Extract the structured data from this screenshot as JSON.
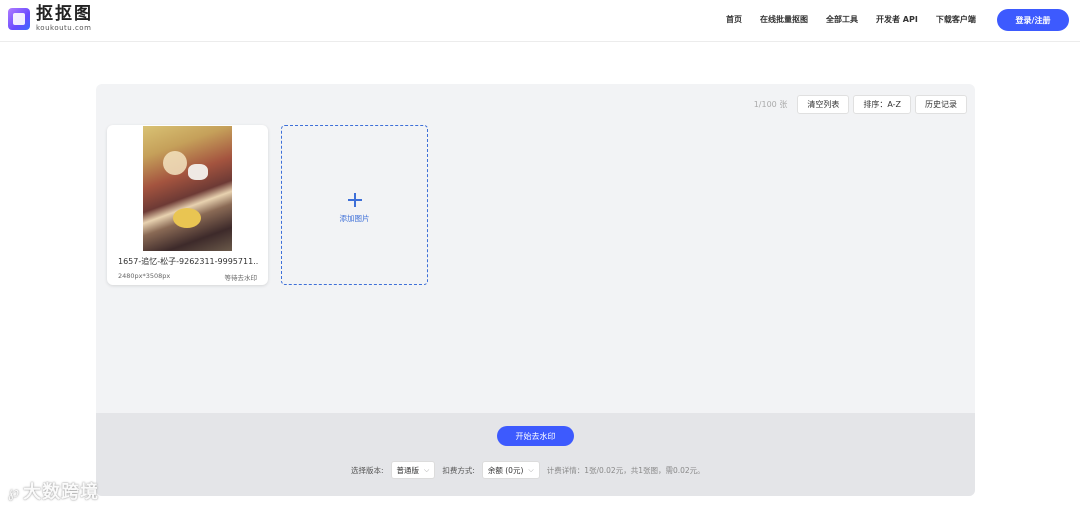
{
  "header": {
    "logo_cn": "抠抠图",
    "logo_en": "koukoutu.com",
    "nav": [
      "首页",
      "在线批量抠图",
      "全部工具",
      "开发者 API",
      "下载客户端"
    ],
    "login": "登录/注册"
  },
  "toolbar": {
    "count": "1/100 张",
    "clear": "清空列表",
    "sort": "排序：A-Z",
    "history": "历史记录"
  },
  "card": {
    "name": "1657-追忆-松子-9262311-9995711...",
    "size": "2480px*3508px",
    "status": "等待去水印"
  },
  "add": {
    "label": "添加图片"
  },
  "footer": {
    "start": "开始去水印",
    "version_label": "选择版本:",
    "version_value": "普通版",
    "pay_label": "扣费方式:",
    "pay_value": "余额 (0元)",
    "detail": "计费详情：1张/0.02元，共1张图，需0.02元。"
  },
  "watermark": {
    "text": "大数跨境"
  },
  "colors": {
    "accent": "#3d5afe",
    "dashed": "#3d6fd8",
    "panel": "#f2f3f5"
  }
}
